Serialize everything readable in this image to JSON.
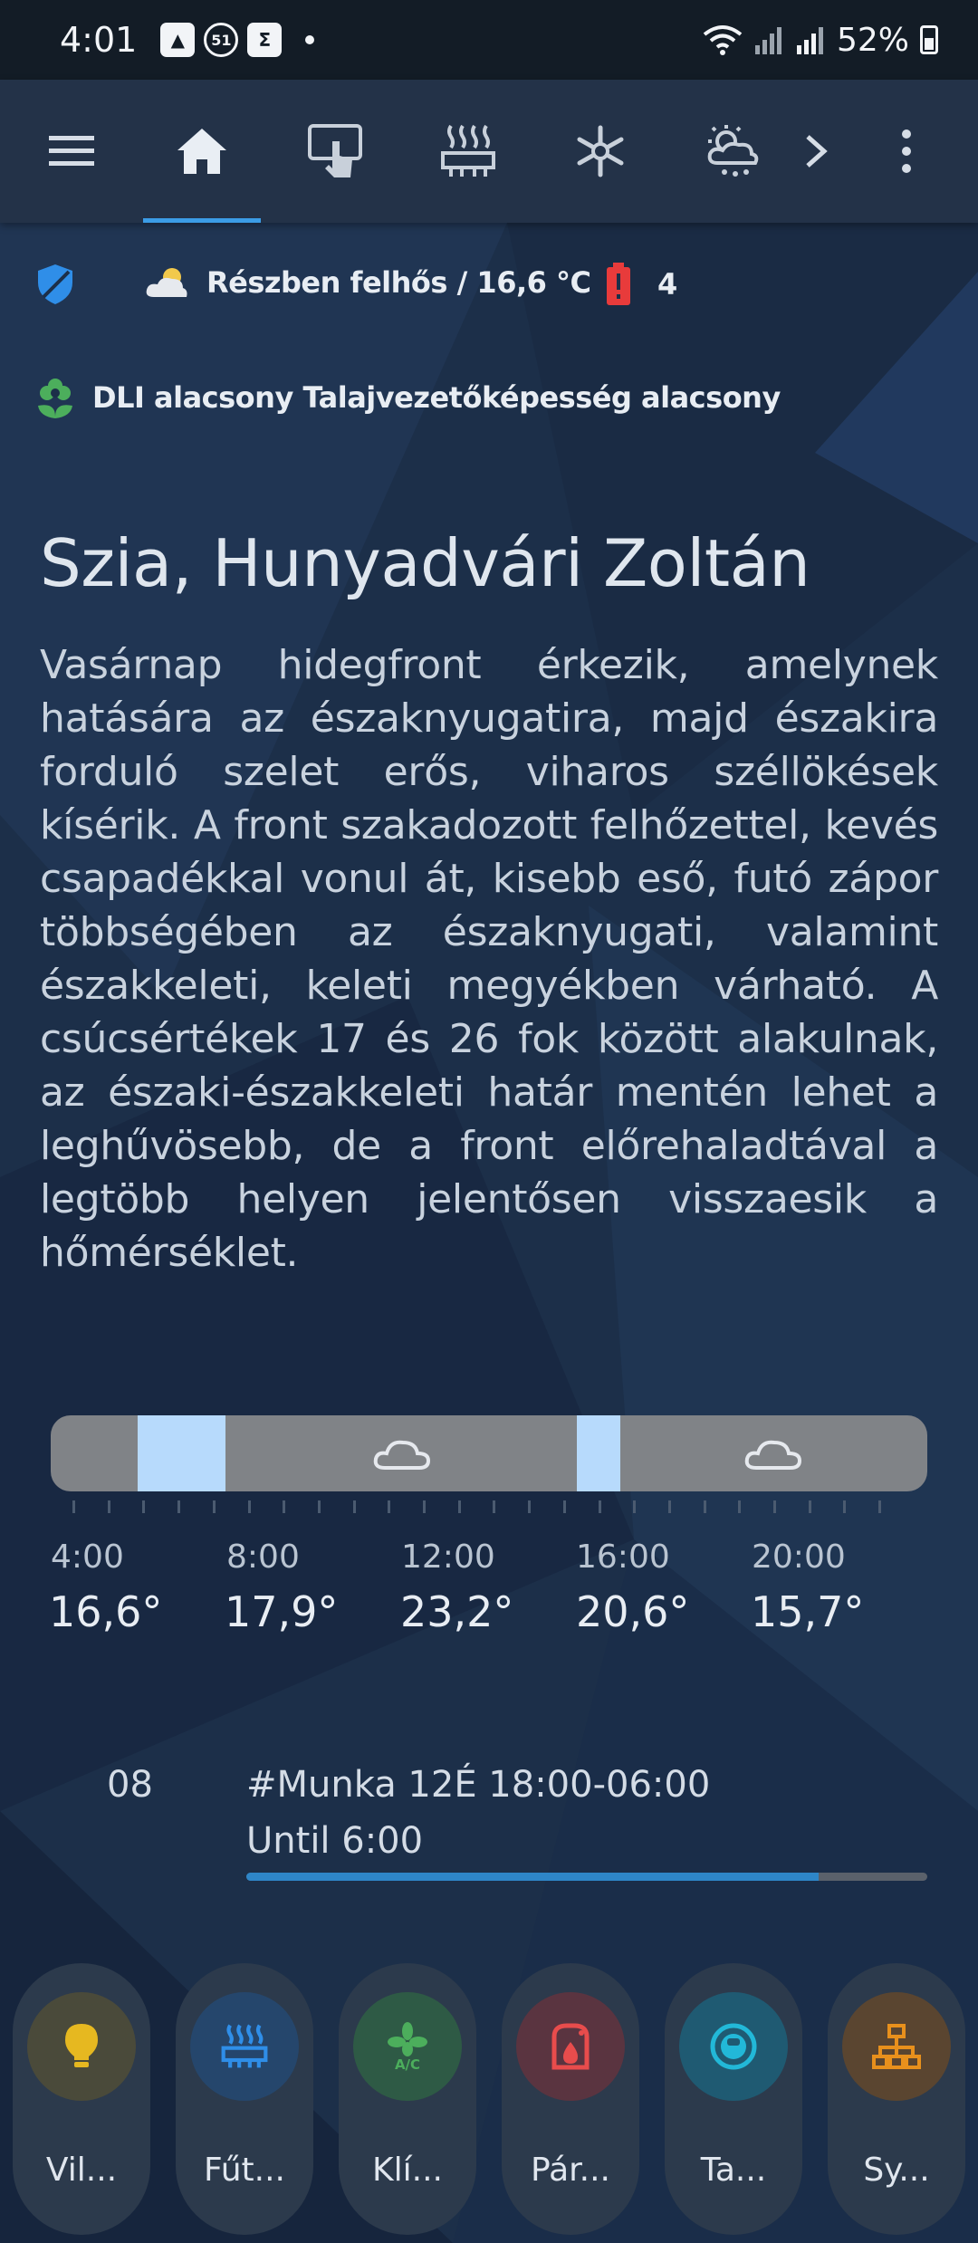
{
  "status_bar": {
    "time": "4:01",
    "notif_badge": "51",
    "battery": "52%"
  },
  "nav": {
    "items": [
      "menu-icon",
      "home-icon",
      "touch-icon",
      "heater-icon",
      "snowflake-icon",
      "weather-icon",
      "chevron-right-icon",
      "more-icon"
    ],
    "active": "home-icon"
  },
  "info": {
    "weather_text": "Részben felhős / 16,6 °C",
    "alerts_count": "4",
    "plant_text": "DLI alacsony Talajvezetőképesség alacsony"
  },
  "greeting": "Szia, Hunyadvári Zoltán",
  "forecast": "Vasárnap hidegfront érkezik, amelynek hatására az északnyugatira, majd északira forduló szelet erős, viharos széllökések kísérik. A front szakadozott felhőzettel, kevés csapadékkal vonul át, kisebb eső, futó zápor többségében az északnyugati, valamint északkeleti, keleti megyékben várható. A csúcsértékek 17 és 26 fok között alakulnak, az északi-északkeleti határ mentén lehet a leghűvösebb, de a front előrehaladtával a legtöbb helyen jelentősen visszaesik a hőmérséklet.",
  "hourly": [
    {
      "time": "4:00",
      "temp": "16,6°"
    },
    {
      "time": "8:00",
      "temp": "17,9°"
    },
    {
      "time": "12:00",
      "temp": "23,2°"
    },
    {
      "time": "16:00",
      "temp": "20,6°"
    },
    {
      "time": "20:00",
      "temp": "15,7°"
    }
  ],
  "event": {
    "day": "08",
    "title": "#Munka 12É 18:00-06:00",
    "until": "Until 6:00",
    "progress": 0.84
  },
  "shortcuts": [
    {
      "label": "Vil...",
      "icon": "bulb-icon",
      "color": "#e6b820",
      "bg": "#4a4a3a"
    },
    {
      "label": "Fűt...",
      "icon": "heater-icon",
      "color": "#2f8ee8",
      "bg": "#25466c"
    },
    {
      "label": "Klí...",
      "icon": "ac-icon",
      "color": "#4cae5c",
      "bg": "#2e5a45"
    },
    {
      "label": "Pár...",
      "icon": "humidifier-icon",
      "color": "#e84c4c",
      "bg": "#5a3440"
    },
    {
      "label": "Ta...",
      "icon": "robot-vacuum-icon",
      "color": "#22b8d8",
      "bg": "#1f5a72"
    },
    {
      "label": "Sy...",
      "icon": "network-icon",
      "color": "#e8901c",
      "bg": "#5a4530"
    }
  ],
  "colors": {
    "accent": "#3b9ce6",
    "topbar": "#233248",
    "background": "#1b2d46"
  }
}
